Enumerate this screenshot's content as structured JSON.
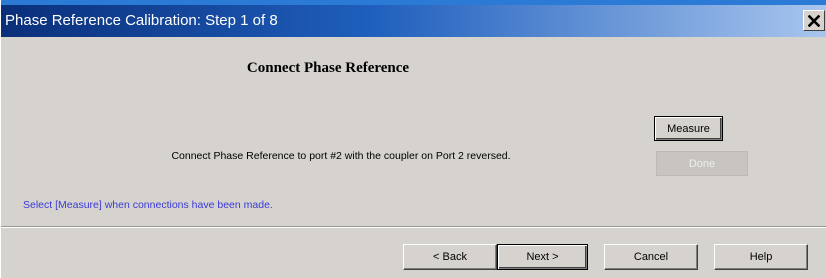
{
  "window": {
    "title": "Phase Reference Calibration: Step 1 of 8",
    "close_icon": "close-x-icon"
  },
  "content": {
    "heading": "Connect Phase Reference",
    "instruction": "Connect Phase Reference to port #2 with the coupler on Port 2 reversed.",
    "hint": "Select [Measure] when connections have been made.",
    "hint_color": "#3a3ad8"
  },
  "actions": {
    "measure_label": "Measure",
    "done_label": "Done"
  },
  "footer": {
    "back_label": "< Back",
    "next_label": "Next >",
    "cancel_label": "Cancel",
    "help_label": "Help"
  },
  "colors": {
    "titlebar_start": "#0a2f7a",
    "titlebar_end": "#a9c6ee",
    "dialog_background": "#d6d3ce"
  }
}
